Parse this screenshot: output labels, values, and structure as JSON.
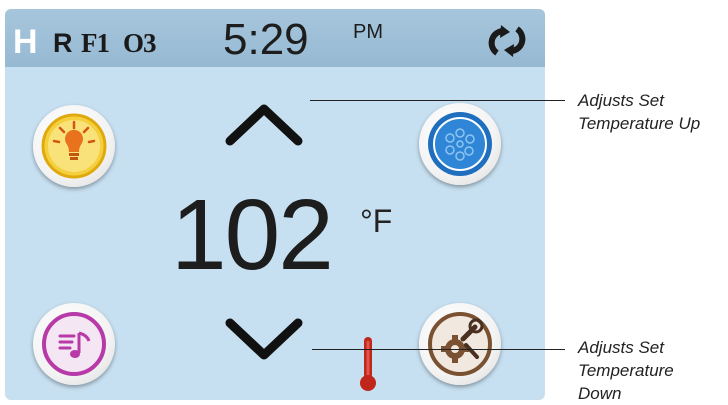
{
  "status_bar": {
    "heater_indicator": "H",
    "r_indicator": "R",
    "f1_indicator": "F1",
    "o3_indicator": "O3",
    "time": "5:29",
    "ampm": "PM"
  },
  "temperature": {
    "value": "102",
    "unit": "°F"
  },
  "callouts": {
    "up_line1": "Adjusts Set",
    "up_line2": "Temperature Up",
    "down_line1": "Adjusts Set",
    "down_line2": "Temperature",
    "down_line3": "Down"
  },
  "colors": {
    "screen_bg": "#c7e0f1",
    "status_bar_bg": "#a6c6dc",
    "light_button": "#f5c518",
    "pump_button": "#1e6fc0",
    "music_button": "#b83aa8",
    "settings_button": "#7a5232",
    "heat_icon": "#c0261c"
  },
  "icons": {
    "light": "lightbulb-icon",
    "pump": "jets-icon",
    "music": "music-icon",
    "settings": "settings-wrench-gear-icon",
    "heat": "thermometer-icon",
    "refresh": "refresh-icon"
  }
}
